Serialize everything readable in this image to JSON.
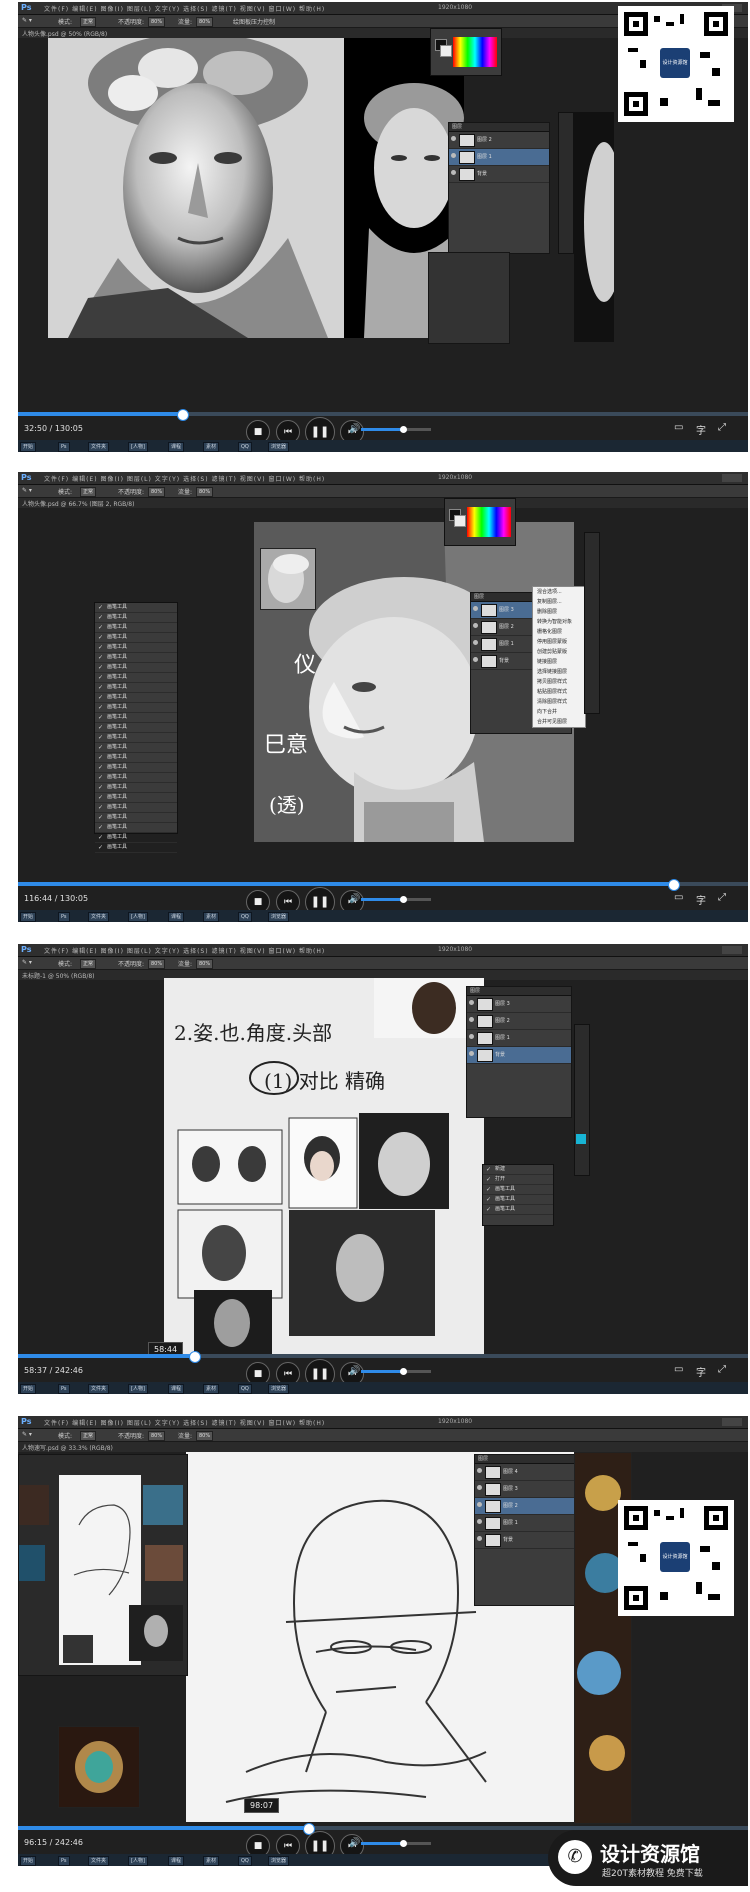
{
  "app": {
    "logo": "Ps",
    "menu_items": [
      "文件(F)",
      "编辑(E)",
      "图像(I)",
      "图层(L)",
      "文字(Y)",
      "选择(S)",
      "滤镜(T)",
      "视图(V)",
      "窗口(W)",
      "帮助(H)"
    ],
    "options": {
      "mode_label": "模式:",
      "mode_value": "正常",
      "opacity_label": "不透明度:",
      "opacity_value": "80%",
      "flow_label": "流量:",
      "flow_value": "80%",
      "extra": "绘图板压力控制"
    }
  },
  "panels": [
    {
      "doc_tab": "人物头像.psd @ 50% (RGB/8)",
      "time": "32:50 / 130:05",
      "progress": 0.224,
      "status_text": "1920x1080",
      "layers": [
        "图层 2",
        "图层 1",
        "背景"
      ],
      "taskbar": [
        "开始",
        "Ps",
        "文件夹",
        "[人物]",
        "课程",
        "素材",
        "QQ",
        "浏览器"
      ]
    },
    {
      "doc_tab": "人物头像.psd @ 66.7% (图层 2, RGB/8)",
      "time": "116:44 / 130:05",
      "progress": 0.897,
      "status_text": "1920x1080",
      "layers": [
        "图层 3",
        "图层 2",
        "图层 1",
        "背景"
      ],
      "context_menu": [
        "混合选项...",
        "复制图层...",
        "删除图层",
        "转换为智能对象",
        "栅格化图层",
        "停用图层蒙版",
        "创建剪贴蒙版",
        "链接图层",
        "选择链接图层",
        "拷贝图层样式",
        "粘贴图层样式",
        "清除图层样式",
        "向下合并",
        "合并可见图层",
        "拼合图像",
        "无颜色",
        "红色",
        "橙色",
        "黄色",
        "绿色",
        "蓝色",
        "紫色",
        "灰色"
      ],
      "brush_list": [
        "画笔工具",
        "画笔工具",
        "画笔工具",
        "画笔工具",
        "画笔工具",
        "画笔工具",
        "画笔工具",
        "画笔工具",
        "画笔工具",
        "画笔工具",
        "画笔工具",
        "画笔工具",
        "画笔工具",
        "画笔工具",
        "画笔工具",
        "画笔工具",
        "画笔工具",
        "画笔工具",
        "画笔工具",
        "画笔工具",
        "画笔工具",
        "画笔工具",
        "画笔工具",
        "画笔工具",
        "画笔工具"
      ],
      "taskbar": [
        "开始",
        "Ps",
        "文件夹",
        "[人物]",
        "课程",
        "素材",
        "QQ",
        "浏览器"
      ]
    },
    {
      "doc_tab": "未标题-1 @ 50% (RGB/8)",
      "time": "58:37 / 242:46",
      "progress": 0.241,
      "hover_time": "58:44",
      "status_text": "1920x1080",
      "layers": [
        "图层 3",
        "图层 2",
        "图层 1",
        "背景"
      ],
      "history": [
        "新建",
        "打开",
        "画笔工具",
        "画笔工具",
        "画笔工具"
      ],
      "taskbar": [
        "开始",
        "Ps",
        "文件夹",
        "[人物]",
        "课程",
        "素材",
        "QQ",
        "浏览器"
      ]
    },
    {
      "doc_tab": "人物速写.psd @ 33.3% (RGB/8)",
      "time": "96:15 / 242:46",
      "progress": 0.397,
      "hover_time": "98:07",
      "status_text": "1920x1080",
      "layers": [
        "图层 4",
        "图层 3",
        "图层 2",
        "图层 1",
        "背景"
      ],
      "taskbar": [
        "开始",
        "Ps",
        "文件夹",
        "[人物]",
        "课程",
        "素材",
        "QQ",
        "浏览器"
      ]
    }
  ],
  "qr": {
    "center_label": "设计资源馆"
  },
  "watermark": {
    "title": "设计资源馆",
    "subtitle": "超20T素材教程 免费下载"
  },
  "colors": {
    "progress": "#2f8be8",
    "ps_blue": "#6cb0ff",
    "selected_layer": "#4a6c93"
  }
}
